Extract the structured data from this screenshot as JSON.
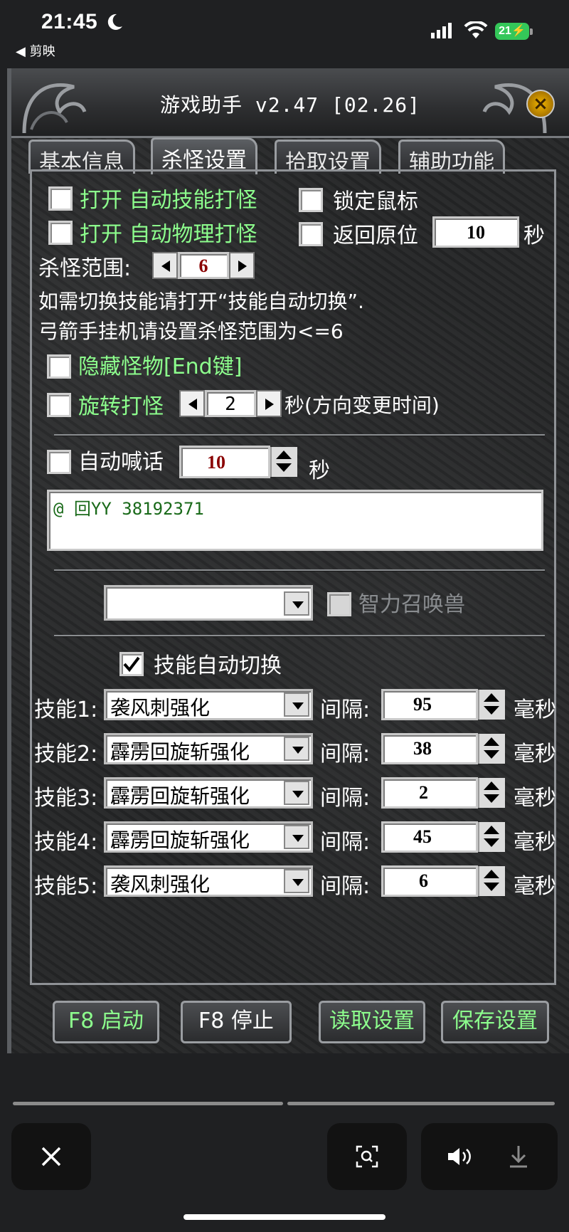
{
  "status": {
    "time": "21:45",
    "back_app": "◀ 剪映",
    "battery": "21"
  },
  "window": {
    "title": "游戏助手 v2.47 [02.26]",
    "close_glyph": "×",
    "tabs": [
      "基本信息",
      "杀怪设置",
      "拾取设置",
      "辅助功能"
    ]
  },
  "options": {
    "auto_skill": "打开 自动技能打怪",
    "auto_physical": "打开 自动物理打怪",
    "lock_mouse": "锁定鼠标",
    "return_pos": "返回原位",
    "return_seconds": "10",
    "seconds_unit": "秒",
    "range_label": "杀怪范围:",
    "range_value": "6",
    "hint1": "如需切换技能请打开“技能自动切换”.",
    "hint2": "弓箭手挂机请设置杀怪范围为<=6",
    "hide_monsters": "隐藏怪物[End键]",
    "rotate_attack": "旋转打怪",
    "rotate_value": "2",
    "rotate_suffix": "秒(方向变更时间)"
  },
  "shout": {
    "label": "自动喊话",
    "value": "10",
    "unit": "秒",
    "message": "@ 回YY 38192371"
  },
  "summon": {
    "select_value": "",
    "label": "智力召唤兽"
  },
  "skills": {
    "toggle_label": "技能自动切换",
    "toggle_checked": true,
    "interval_label": "间隔:",
    "ms_unit": "毫秒",
    "rows": [
      {
        "label": "技能1:",
        "skill": "袭风刺强化",
        "interval": "95"
      },
      {
        "label": "技能2:",
        "skill": "霹雳回旋斩强化",
        "interval": "38"
      },
      {
        "label": "技能3:",
        "skill": "霹雳回旋斩强化",
        "interval": "2"
      },
      {
        "label": "技能4:",
        "skill": "霹雳回旋斩强化",
        "interval": "45"
      },
      {
        "label": "技能5:",
        "skill": "袭风刺强化",
        "interval": "6"
      }
    ]
  },
  "buttons": {
    "start": "F8 启动",
    "stop": "F8 停止",
    "load": "读取设置",
    "save": "保存设置"
  },
  "colors": {
    "green_text": "#8dff8d",
    "value_red": "#8a0000",
    "battery_green": "#34c759"
  }
}
